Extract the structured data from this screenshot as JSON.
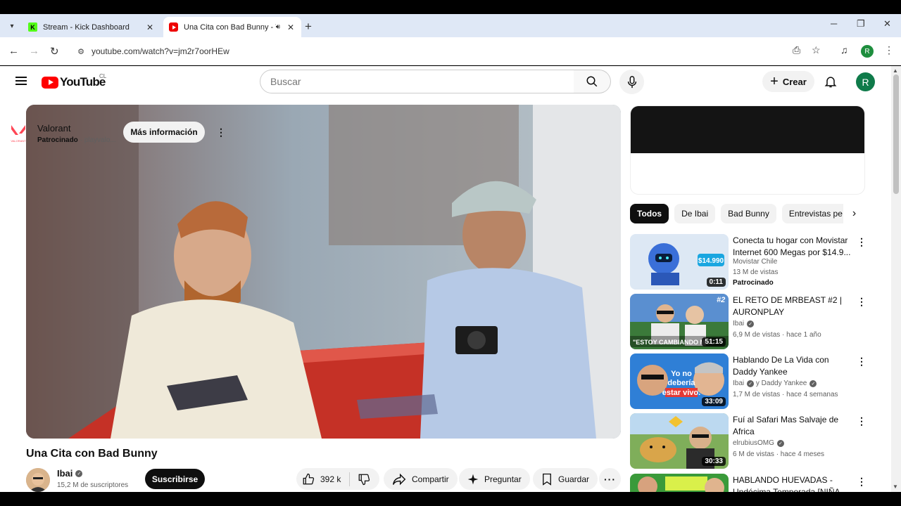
{
  "browser": {
    "tabs": [
      {
        "title": "Stream - Kick Dashboard",
        "favicon": "kick-icon"
      },
      {
        "title": "Una Cita con Bad Bunny - Y",
        "favicon": "youtube-icon",
        "audio": true
      }
    ],
    "url": "youtube.com/watch?v=jm2r7oorHEw",
    "profile_initial": "R"
  },
  "header": {
    "logo": "YouTube",
    "country": "CL",
    "search_placeholder": "Buscar",
    "create_label": "Crear",
    "avatar_initial": "R"
  },
  "video": {
    "title": "Una Cita con Bad Bunny",
    "channel": "Ibai",
    "subscribers": "15,2 M de suscriptores",
    "subscribe_label": "Suscribirse",
    "likes": "392 k",
    "share_label": "Compartir",
    "ask_label": "Preguntar",
    "save_label": "Guardar"
  },
  "ad": {
    "name": "Valorant",
    "sponsored": "Patrocinado",
    "domain": "playvalo...",
    "cta": "Más información",
    "logo_text": "VALORANT"
  },
  "chips": [
    "Todos",
    "De Ibai",
    "Bad Bunny",
    "Entrevistas pe"
  ],
  "recommendations": [
    {
      "title": "Conecta tu hogar con Movistar Internet 600 Megas por $14.9...",
      "channel": "Movistar Chile",
      "meta": "13 M de vistas",
      "badge": "Patrocinado",
      "duration": "0:11",
      "thumb_text": "$14.990"
    },
    {
      "title": "EL RETO DE MRBEAST #2 | AURONPLAY",
      "channel": "Ibai",
      "meta": "6,9 M de vistas · hace 1 año",
      "duration": "51:15",
      "thumb_text": "\"ESTOY CAMBIANDO MUC",
      "thumb_tag": "#2"
    },
    {
      "title": "Hablando De La Vida con Daddy Yankee",
      "channel": "Ibai",
      "channel2": "y Daddy Yankee",
      "meta": "1,7 M de vistas · hace 4 semanas",
      "duration": "33:09",
      "thumb_text": "Yo no debería estar vivo."
    },
    {
      "title": "Fuí al Safari Mas Salvaje de Africa",
      "channel": "elrubiusOMG",
      "meta": "6 M de vistas · hace 4 meses",
      "duration": "30:33"
    },
    {
      "title": "HABLANDO HUEVADAS - Undécima Temporada [NIÑA",
      "channel": "",
      "meta": ""
    }
  ],
  "colors": {
    "brand_red": "#ff0000",
    "tab_strip": "#dfe8f6",
    "chip_active": "#0f0f0f"
  }
}
